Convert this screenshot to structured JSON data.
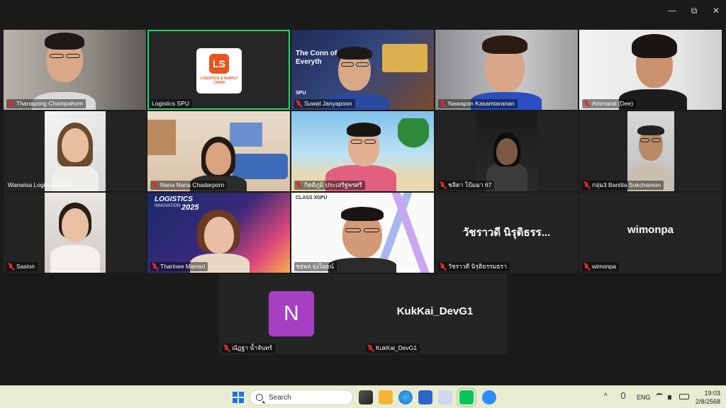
{
  "window": {
    "minimize_glyph": "—",
    "maximize_glyph": "⧉",
    "close_glyph": "✕"
  },
  "participants": [
    {
      "name": "Thanapong Champahom",
      "muted": true
    },
    {
      "name": "Logistics SPU",
      "muted": false,
      "logo_text": "LOGISTICS & SUPPLY CHAIN"
    },
    {
      "name": "Suwat Janyapoon",
      "muted": true,
      "bg_text": "The Conn of Everyth",
      "bg_brand": "SPU"
    },
    {
      "name": "Nawapon Kasamtaranan",
      "muted": true
    },
    {
      "name": "Ammarat (Dee)",
      "muted": true
    },
    {
      "name": "Wanwisa Logistics SPU",
      "muted": false
    },
    {
      "name": "Nana Nana Chadarporn",
      "muted": true
    },
    {
      "name": "กิตติภูมิ ประเสริฐพรศรี",
      "muted": true
    },
    {
      "name": "ชลิดา โป้มมา 67",
      "muted": true
    },
    {
      "name": "กลุ่ม3 Bantita Sukchareon",
      "muted": true
    },
    {
      "name": "Sasion",
      "muted": true
    },
    {
      "name": "Tharinee Manisri",
      "muted": true,
      "bg_title": "LOGISTICS",
      "bg_sub": "INNOVATION",
      "bg_year": "2025"
    },
    {
      "name": "ชยพล ยุ่งไมยน์",
      "muted": false,
      "bg_brand1": "CLASS X",
      "bg_brand2": "SPU"
    },
    {
      "name": "วัชราวดี นิรุติธรรมธรา",
      "muted": true,
      "display_name": "วัชราวดี นิรุติธรร..."
    },
    {
      "name": "wimonpa",
      "muted": true,
      "display_name": "wimonpa"
    },
    {
      "name": "ณัฏฐา น้ำจันทร์",
      "muted": true,
      "avatar_letter": "N"
    },
    {
      "name": "KukKai_DevG1",
      "muted": true,
      "display_name": "KukKai_DevG1"
    }
  ],
  "taskbar": {
    "search_placeholder": "Search",
    "language": "ENG",
    "time": "19:03",
    "date": "2/8/2568",
    "chevron": "^"
  },
  "colors": {
    "active_speaker": "#27d36b",
    "muted_icon": "#e02828",
    "avatar_bg": "#a63fc1",
    "taskbar_bg": "#e8ecd0"
  }
}
